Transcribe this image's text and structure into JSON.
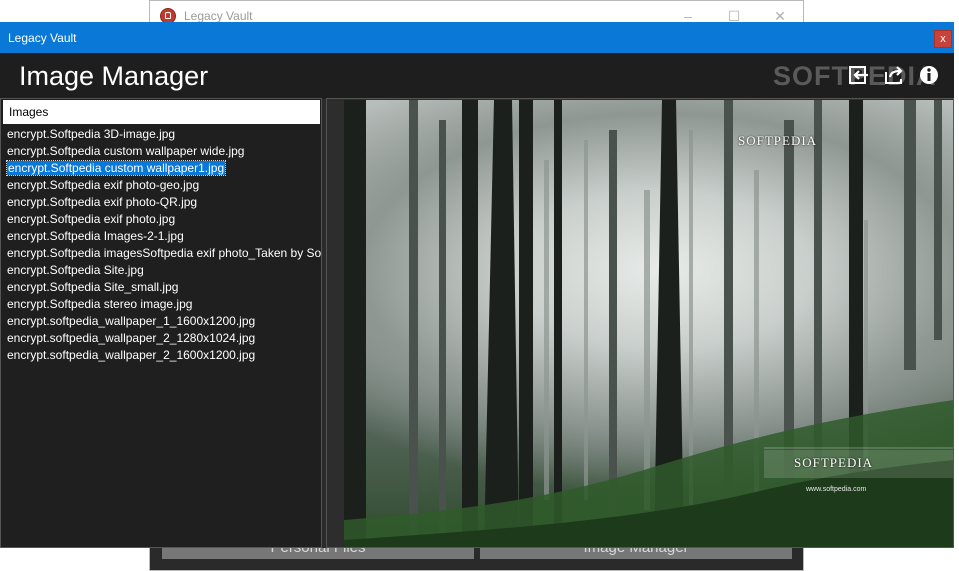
{
  "background_window": {
    "title": "Legacy Vault",
    "controls": [
      "–",
      "☐",
      "✕"
    ],
    "tabs": [
      "Personal Files",
      "Image Manager"
    ]
  },
  "window": {
    "title": "Legacy Vault",
    "close_label": "x",
    "accent_color": "#0a78d7"
  },
  "header": {
    "title": "Image Manager",
    "watermark": "SOFTPEDIA",
    "buttons": [
      {
        "icon": "import-icon"
      },
      {
        "icon": "export-icon"
      },
      {
        "icon": "info-icon"
      }
    ]
  },
  "list": {
    "header": "Images",
    "selected_index": 2,
    "items": [
      "encrypt.Softpedia 3D-image.jpg",
      "encrypt.Softpedia custom wallpaper wide.jpg",
      "encrypt.Softpedia custom wallpaper1.jpg",
      "encrypt.Softpedia exif photo-geo.jpg",
      "encrypt.Softpedia exif photo-QR.jpg",
      "encrypt.Softpedia exif photo.jpg",
      "encrypt.Softpedia Images-2-1.jpg",
      "encrypt.Softpedia imagesSoftpedia exif photo_Taken by Softpedia",
      "encrypt.Softpedia Site.jpg",
      "encrypt.Softpedia Site_small.jpg",
      "encrypt.Softpedia stereo image.jpg",
      "encrypt.softpedia_wallpaper_1_1600x1200.jpg",
      "encrypt.softpedia_wallpaper_2_1280x1024.jpg",
      "encrypt.softpedia_wallpaper_2_1600x1200.jpg"
    ]
  },
  "preview": {
    "watermark_top": "SOFTPEDIA",
    "watermark_bottom": "SOFTPEDIA",
    "watermark_url": "www.softpedia.com"
  }
}
